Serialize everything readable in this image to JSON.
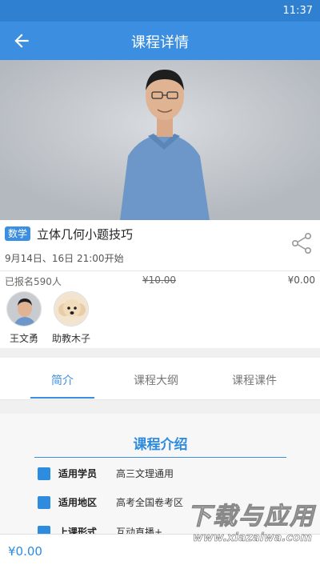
{
  "status_bar": {
    "time": "11:37"
  },
  "app_bar": {
    "title": "课程详情",
    "back_icon": "arrow-left-icon"
  },
  "course": {
    "subject_tag": "数学",
    "title": "立体几何小题技巧",
    "schedule": "9月14日、16日 21:00开始",
    "enrolled": "已报名590人",
    "original_price": "¥10.00",
    "price": "¥0.00",
    "share_icon": "share-icon"
  },
  "teachers": [
    {
      "name": "王文勇"
    },
    {
      "name": "助教木子"
    }
  ],
  "tabs": [
    {
      "label": "简介",
      "active": true
    },
    {
      "label": "课程大纲",
      "active": false
    },
    {
      "label": "课程课件",
      "active": false
    }
  ],
  "intro": {
    "heading": "课程介绍",
    "rows": [
      {
        "key": "适用学员",
        "value": "高三文理通用"
      },
      {
        "key": "适用地区",
        "value": "高考全国卷考区"
      },
      {
        "key": "上课形式",
        "value": "互动直播+"
      }
    ]
  },
  "bottom_bar": {
    "price": "¥0.00"
  },
  "watermark": {
    "main": "下载与应用",
    "url": "www.xiazaiwa.com"
  },
  "colors": {
    "primary": "#3b8ee0",
    "status_bar": "#2f80d1"
  }
}
